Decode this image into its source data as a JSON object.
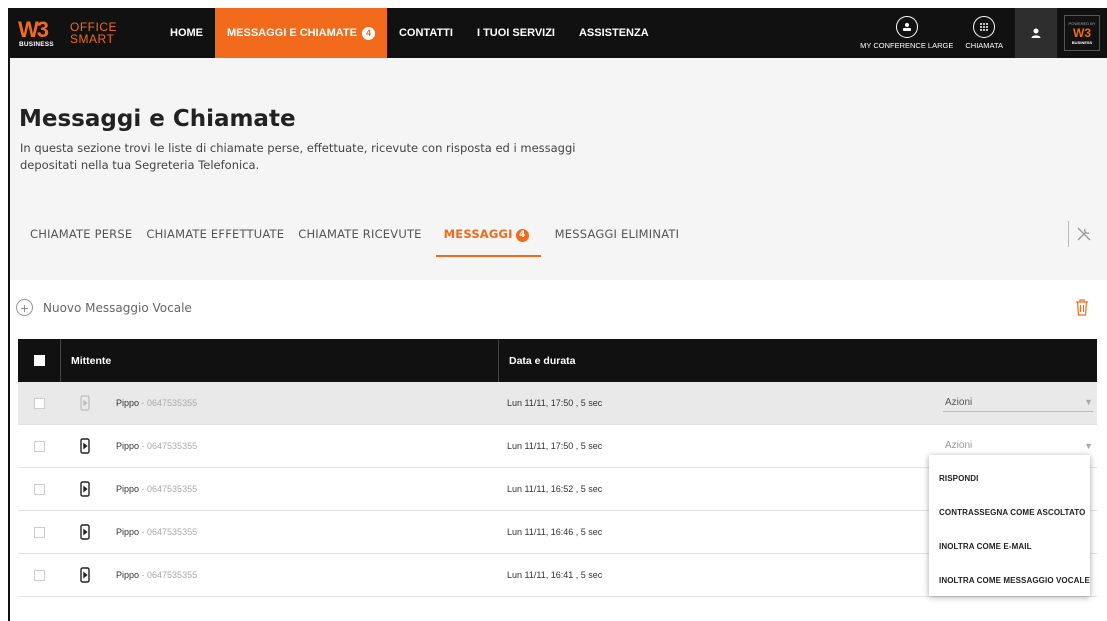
{
  "brand": {
    "logo_w3": "W3",
    "logo_business": "BUSINESS",
    "product_line1": "OFFICE",
    "product_line2": "SMART"
  },
  "nav": {
    "items": [
      {
        "label": "HOME"
      },
      {
        "label": "MESSAGGI E CHIAMATE",
        "badge": "4",
        "active": true
      },
      {
        "label": "CONTATTI"
      },
      {
        "label": "I TUOI SERVIZI"
      },
      {
        "label": "ASSISTENZA"
      }
    ]
  },
  "top_right": {
    "conference_label": "MY CONFERENCE LARGE",
    "call_label": "CHIAMATA",
    "powered_line1": "POWERED BY",
    "powered_logo": "W3",
    "powered_line3": "BUSINESS"
  },
  "header": {
    "title": "Messaggi e Chiamate",
    "description": "In questa sezione trovi le liste di chiamate perse, effettuate, ricevute con risposta ed i messaggi depositati nella tua Segreteria Telefonica."
  },
  "tabs": [
    {
      "label": "CHIAMATE PERSE"
    },
    {
      "label": "CHIAMATE EFFETTUATE"
    },
    {
      "label": "CHIAMATE RICEVUTE"
    },
    {
      "label": "MESSAGGI",
      "badge": "4",
      "active": true
    },
    {
      "label": "MESSAGGI ELIMINATI"
    }
  ],
  "actions": {
    "new_message_label": "Nuovo Messaggio Vocale"
  },
  "table": {
    "columns": [
      "Mittente",
      "Data e durata"
    ],
    "rows": [
      {
        "name": "Pippo",
        "number": " - 0647535355",
        "date": "Lun 11/11, 17:50 , 5 sec",
        "actions": "Azioni"
      },
      {
        "name": "Pippo",
        "number": " - 0647535355",
        "date": "Lun 11/11, 17:50 , 5 sec",
        "actions": "Azioni"
      },
      {
        "name": "Pippo",
        "number": " - 0647535355",
        "date": "Lun 11/11, 16:52 , 5 sec"
      },
      {
        "name": "Pippo",
        "number": " - 0647535355",
        "date": "Lun 11/11, 16:46 , 5 sec"
      },
      {
        "name": "Pippo",
        "number": " - 0647535355",
        "date": "Lun 11/11, 16:41 , 5 sec"
      }
    ]
  },
  "dropdown": {
    "items": [
      "RISPONDI",
      "CONTRASSEGNA COME ASCOLTATO",
      "INOLTRA COME E-MAIL",
      "INOLTRA COME MESSAGGIO VOCALE"
    ]
  },
  "colors": {
    "accent": "#f26a1b",
    "topbar": "#111111",
    "table_header": "#111111"
  }
}
